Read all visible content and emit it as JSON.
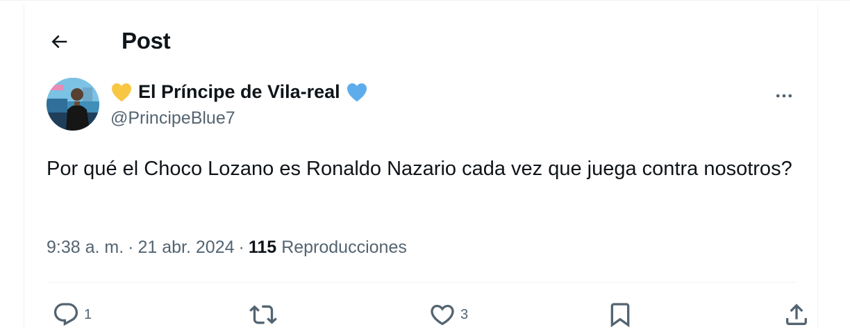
{
  "header": {
    "back_icon": "arrow-left-icon",
    "title": "Post"
  },
  "author": {
    "display_name": "El Príncipe de Vila-real",
    "handle": "@PrincipeBlue7",
    "leading_emoji": "yellow-heart-icon",
    "trailing_emoji": "blue-heart-icon",
    "more_icon": "more-horizontal-icon"
  },
  "tweet": {
    "text": "Por qué el Choco Lozano es Ronaldo Nazario cada vez que juega contra nosotros?",
    "time": "9:38 a. m.",
    "date": "21 abr. 2024",
    "separator": "·",
    "views_count": "115",
    "views_label": "Reproducciones"
  },
  "actions": {
    "reply": {
      "icon": "reply-icon",
      "count": "1"
    },
    "repost": {
      "icon": "repost-icon",
      "count": ""
    },
    "like": {
      "icon": "heart-icon",
      "count": "3"
    },
    "bookmark": {
      "icon": "bookmark-icon",
      "count": ""
    },
    "share": {
      "icon": "share-icon",
      "count": ""
    }
  },
  "colors": {
    "text_primary": "#0f1419",
    "text_secondary": "#536471",
    "divider": "#eff3f4",
    "yellow_heart": "#f7c744",
    "blue_heart": "#5dadec"
  }
}
